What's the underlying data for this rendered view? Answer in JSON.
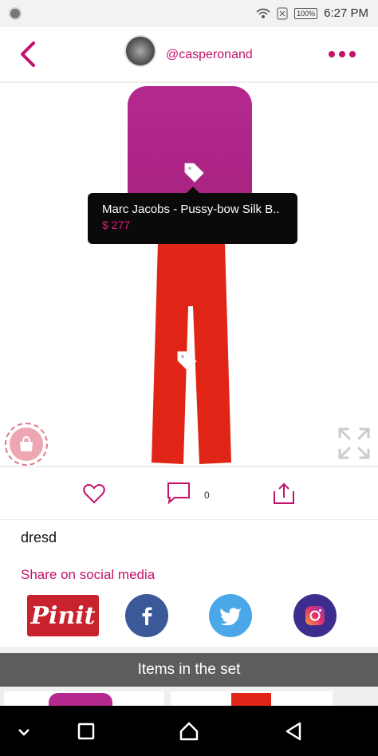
{
  "status": {
    "time": "6:27 PM",
    "battery": "100%"
  },
  "header": {
    "username": "@casperonand"
  },
  "product_popup": {
    "name": "Marc Jacobs - Pussy-bow Silk B..",
    "price": "$ 277"
  },
  "actions": {
    "comment_count": "0"
  },
  "post": {
    "caption": "dresd"
  },
  "social": {
    "title": "Share on social media",
    "pinterest_label": "Pinit"
  },
  "items_section": {
    "title": "Items in the set"
  },
  "colors": {
    "brand": "#c2126b",
    "price": "#e5197f",
    "shirt": "#b5298e",
    "pants": "#e02516"
  },
  "icons": [
    "back-icon",
    "more-icon",
    "tag-icon",
    "shopping-bag-icon",
    "expand-icon",
    "heart-icon",
    "comment-icon",
    "share-icon",
    "facebook-icon",
    "twitter-icon",
    "instagram-icon"
  ]
}
